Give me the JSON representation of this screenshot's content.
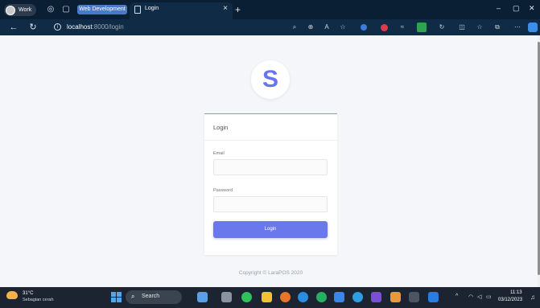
{
  "browser": {
    "profile_label": "Work",
    "tab_group_label": "Web Development",
    "active_tab_title": "Login",
    "url_host": "localhost",
    "url_path": ":8000/login"
  },
  "page": {
    "logo_letter": "S",
    "card_title": "Login",
    "email_label": "Email",
    "email_value": "",
    "password_label": "Password",
    "password_value": "",
    "login_button_label": "Login",
    "copyright": "Copyright © LaraPOS 2020"
  },
  "taskbar": {
    "weather_temp": "31°C",
    "weather_desc": "Sebagian cerah",
    "search_label": "Search",
    "time": "11:13",
    "date": "03/12/2023"
  },
  "colors": {
    "accent": "#6a78ee",
    "tab_group": "#4a79c8"
  }
}
